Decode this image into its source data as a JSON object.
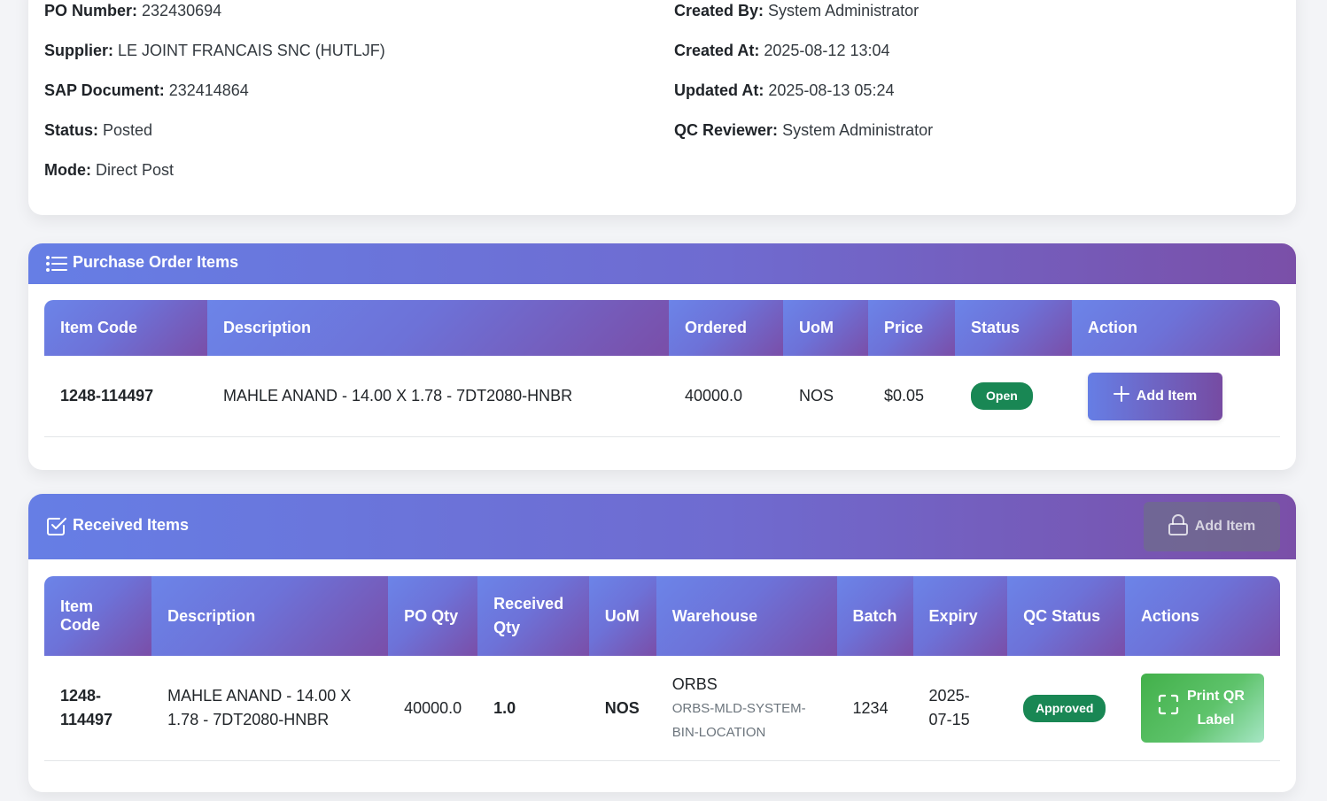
{
  "po_info": {
    "left": [
      {
        "label": "PO Number:",
        "value": "232430694"
      },
      {
        "label": "Supplier:",
        "value": "LE JOINT FRANCAIS SNC (HUTLJF)"
      },
      {
        "label": "SAP Document:",
        "value": "232414864"
      },
      {
        "label": "Status:",
        "value": "Posted"
      },
      {
        "label": "Mode:",
        "value": "Direct Post"
      }
    ],
    "right": [
      {
        "label": "Created By:",
        "value": "System Administrator"
      },
      {
        "label": "Created At:",
        "value": "2025-08-12 13:04"
      },
      {
        "label": "Updated At:",
        "value": "2025-08-13 05:24"
      },
      {
        "label": "QC Reviewer:",
        "value": "System Administrator"
      }
    ]
  },
  "po_items": {
    "title": "Purchase Order Items",
    "icon": "list-icon",
    "columns": [
      "Item Code",
      "Description",
      "Ordered",
      "UoM",
      "Price",
      "Status",
      "Action"
    ],
    "rows": [
      {
        "item_code": "1248-114497",
        "description": "MAHLE ANAND - 14.00 X 1.78 - 7DT2080-HNBR",
        "ordered": "40000.0",
        "uom": "NOS",
        "price": "$0.05",
        "status": "Open",
        "action": "Add Item"
      }
    ]
  },
  "received_items": {
    "title": "Received Items",
    "icon": "checkbox-icon",
    "locked_button": "Add Item",
    "columns": [
      "Item Code",
      "Description",
      "PO Qty",
      "Received Qty",
      "UoM",
      "Warehouse",
      "Batch",
      "Expiry",
      "QC Status",
      "Actions"
    ],
    "rows": [
      {
        "item_code": "1248-114497",
        "description": "MAHLE ANAND - 14.00 X 1.78 - 7DT2080-HNBR",
        "po_qty": "40000.0",
        "received_qty": "1.0",
        "uom": "NOS",
        "warehouse": "ORBS",
        "bin": "ORBS-MLD-SYSTEM-BIN-LOCATION",
        "batch": "1234",
        "expiry": "2025-07-15",
        "qc_status": "Approved",
        "action": "Print QR Label"
      }
    ]
  },
  "colors": {
    "accent_start": "#667ee5",
    "accent_end": "#764ba2",
    "success": "#198754",
    "qr_button": "#4caf50"
  }
}
